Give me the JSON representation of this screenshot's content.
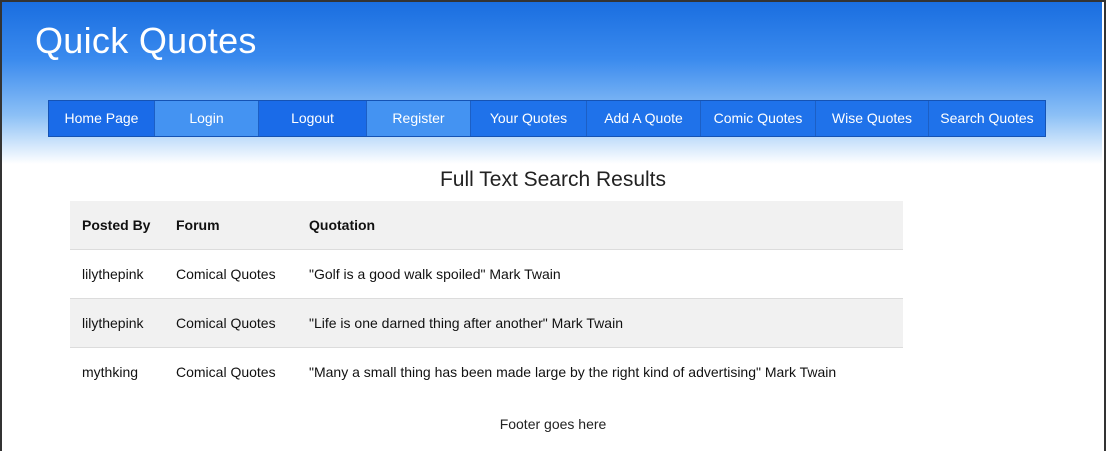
{
  "header": {
    "site_title": "Quick Quotes"
  },
  "nav": {
    "items": [
      {
        "label": "Home Page"
      },
      {
        "label": "Login"
      },
      {
        "label": "Logout"
      },
      {
        "label": "Register"
      },
      {
        "label": "Your Quotes"
      },
      {
        "label": "Add A Quote"
      },
      {
        "label": "Comic Quotes"
      },
      {
        "label": "Wise Quotes"
      },
      {
        "label": "Search Quotes"
      }
    ]
  },
  "main": {
    "results_title": "Full Text Search Results",
    "table": {
      "columns": [
        "Posted By",
        "Forum",
        "Quotation"
      ],
      "rows": [
        [
          "lilythepink",
          "Comical Quotes",
          "\"Golf is a good walk spoiled\" Mark Twain"
        ],
        [
          "lilythepink",
          "Comical Quotes",
          "\"Life is one darned thing after another\" Mark Twain"
        ],
        [
          "mythking",
          "Comical Quotes",
          "\"Many a small thing has been made large by the right kind of advertising\" Mark Twain"
        ]
      ]
    }
  },
  "footer": {
    "text": "Footer goes here"
  },
  "colors": {
    "header_blue": "#1a6ee0",
    "nav_dark": "#1a6be8",
    "nav_light": "#4493f2"
  }
}
